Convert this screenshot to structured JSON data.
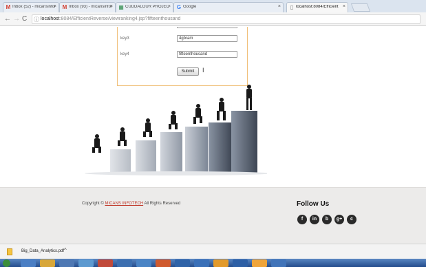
{
  "browser": {
    "tabs": [
      {
        "title": "Inbox (52) - micansinfor",
        "icon": "gmail-icon",
        "icon_glyph": "M",
        "icon_color": "#d23f31",
        "active": false
      },
      {
        "title": "Inbox (93) - micansinfor",
        "icon": "gmail-icon",
        "icon_glyph": "M",
        "icon_color": "#d23f31",
        "active": false
      },
      {
        "title": "CUDDALOUR PROJECT /",
        "icon": "app-icon",
        "icon_glyph": "▦",
        "icon_color": "#2a8a4a",
        "active": false
      },
      {
        "title": "Google",
        "icon": "google-icon",
        "icon_glyph": "G",
        "icon_color": "#4285f4",
        "active": false
      },
      {
        "title": "localhost:8084/Efficient",
        "icon": "page-icon",
        "icon_glyph": "▯",
        "icon_color": "#777777",
        "active": true
      }
    ],
    "tab_close_glyph": "×",
    "address": {
      "host": "localhost",
      "rest": ":8084/EfficientReverse/viewranking4.jsp?fifteenthousand"
    }
  },
  "form": {
    "fields": [
      {
        "label": "key3",
        "value": "4gbram"
      },
      {
        "label": "key4",
        "value": "fifteenthousand"
      }
    ],
    "submit_label": "Submit"
  },
  "footer": {
    "copyright_prefix": "Copyright ©",
    "copyright_org": "MICANS INFOTECH",
    "copyright_suffix": "All Rights Reserved",
    "follow_title": "Follow Us",
    "social": [
      {
        "name": "facebook-icon",
        "glyph": "f"
      },
      {
        "name": "linkedin-icon",
        "glyph": "in"
      },
      {
        "name": "blogger-icon",
        "glyph": "b"
      },
      {
        "name": "google-plus-icon",
        "glyph": "g+"
      },
      {
        "name": "crescent-icon",
        "glyph": "c"
      }
    ]
  },
  "downloads": {
    "file": "Big_Data_Analytics.pdf",
    "chevron": "^"
  },
  "colors": {
    "form_border": "#f0c07a",
    "footer_bg": "#ecebea",
    "taskbar": "#234c8c"
  }
}
